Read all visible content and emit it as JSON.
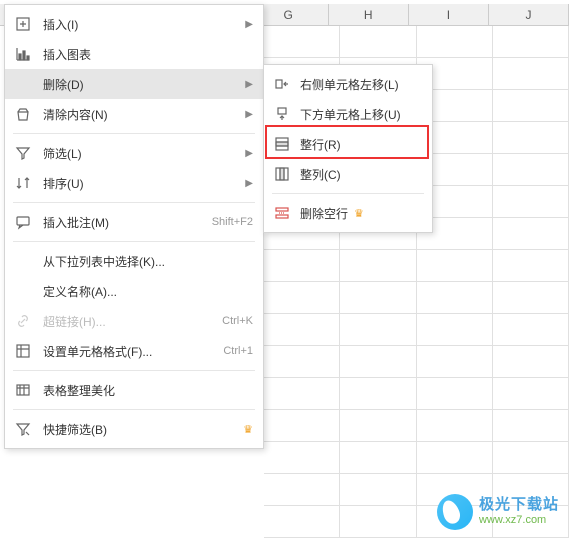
{
  "columns": [
    "G",
    "H",
    "I",
    "J"
  ],
  "main_menu": {
    "insert": "插入(I)",
    "insert_chart": "插入图表",
    "delete": "删除(D)",
    "clear": "清除内容(N)",
    "filter": "筛选(L)",
    "sort": "排序(U)",
    "insert_comment": "插入批注(M)",
    "insert_comment_shortcut": "Shift+F2",
    "select_from_list": "从下拉列表中选择(K)...",
    "define_name": "定义名称(A)...",
    "hyperlink": "超链接(H)...",
    "hyperlink_shortcut": "Ctrl+K",
    "format_cells": "设置单元格格式(F)...",
    "format_cells_shortcut": "Ctrl+1",
    "beautify": "表格整理美化",
    "quick_filter": "快捷筛选(B)"
  },
  "submenu": {
    "shift_left": "右侧单元格左移(L)",
    "shift_up": "下方单元格上移(U)",
    "entire_row": "整行(R)",
    "entire_col": "整列(C)",
    "delete_blank": "删除空行"
  },
  "watermark": {
    "title": "极光下载站",
    "url": "www.xz7.com"
  }
}
